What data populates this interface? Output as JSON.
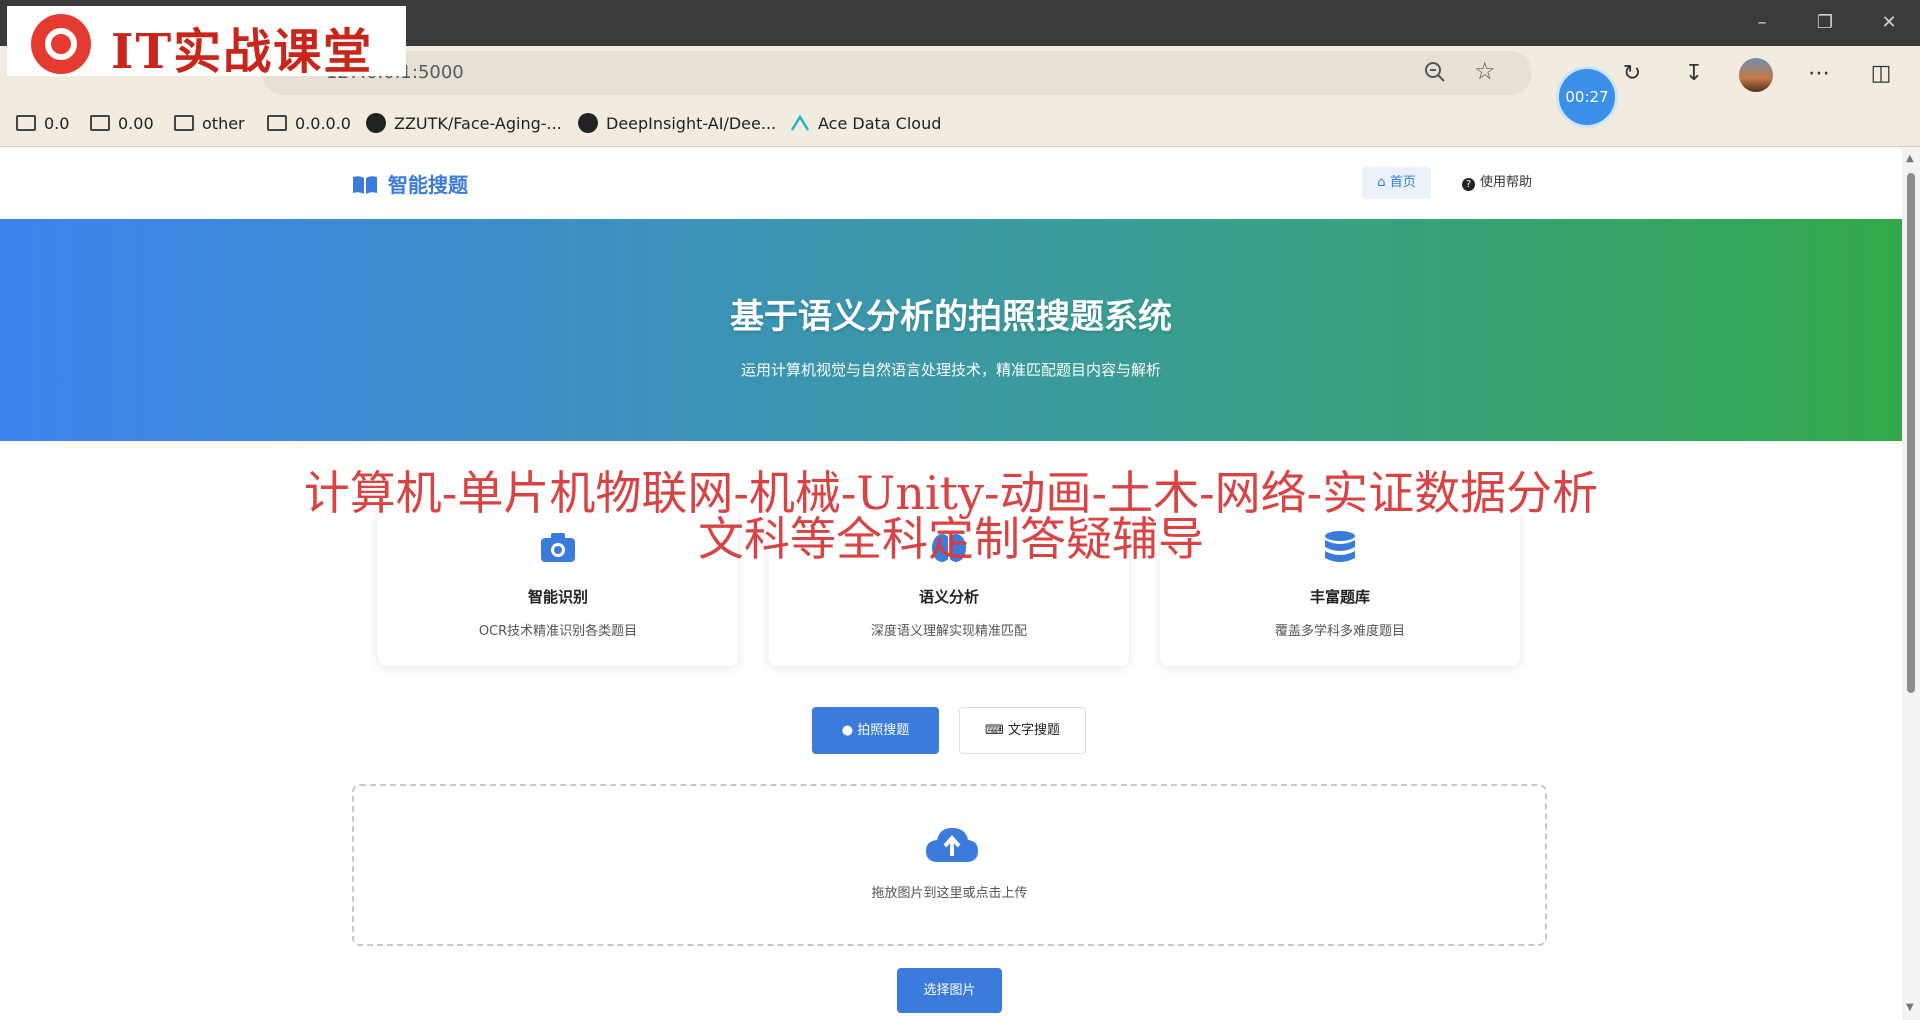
{
  "browser": {
    "url": "127.0.0.1:5000",
    "timer": "00:27",
    "bookmarks": [
      {
        "label": "0.0"
      },
      {
        "label": "0.00"
      },
      {
        "label": "other"
      },
      {
        "label": "0.0.0.0"
      },
      {
        "label": "ZZUTK/Face-Aging-..."
      },
      {
        "label": "DeepInsight-AI/Dee..."
      },
      {
        "label": "Ace Data Cloud"
      }
    ]
  },
  "watermark": {
    "logo_text": "IT实战课堂",
    "line1": "计算机-单片机物联网-机械-Unity-动画-土木-网络-实证数据分析",
    "line2": "文科等全科定制答疑辅导"
  },
  "nav": {
    "brand": "智能搜题",
    "home": "首页",
    "help": "使用帮助"
  },
  "hero": {
    "title": "基于语义分析的拍照搜题系统",
    "subtitle": "运用计算机视觉与自然语言处理技术，精准匹配题目内容与解析"
  },
  "features": [
    {
      "icon": "camera-icon",
      "title": "智能识别",
      "desc": "OCR技术精准识别各类题目"
    },
    {
      "icon": "brain-icon",
      "title": "语义分析",
      "desc": "深度语义理解实现精准匹配"
    },
    {
      "icon": "database-icon",
      "title": "丰富题库",
      "desc": "覆盖多学科多难度题目"
    }
  ],
  "search": {
    "photo_tab": "拍照搜题",
    "text_tab": "文字搜题",
    "dropzone_text": "拖放图片到这里或点击上传",
    "select_button": "选择图片"
  },
  "colors": {
    "accent": "#3a7bdc",
    "hero_start": "#3f82ee",
    "hero_end": "#33a84a",
    "watermark": "#d63a3a"
  }
}
